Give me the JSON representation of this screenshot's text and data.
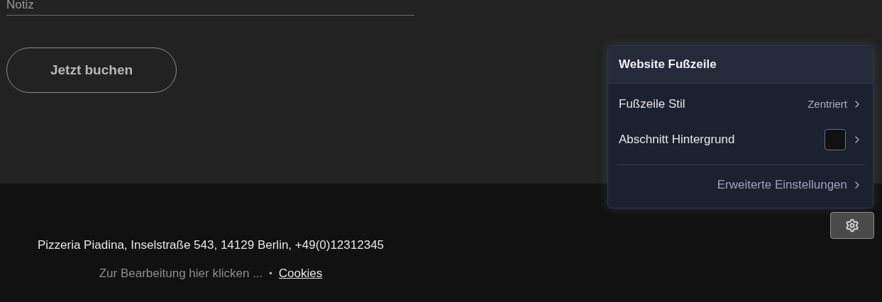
{
  "form": {
    "note_field": {
      "placeholder": "Notiz"
    },
    "submit_button": "Jetzt buchen"
  },
  "footer": {
    "address": "Pizzeria Piadina, Inselstraße 543, 14129 Berlin, +49(0)12312345",
    "edit_hint": "Zur Bearbeitung hier klicken ...",
    "separator": "•",
    "link": "Cookies"
  },
  "settings_panel": {
    "title": "Website Fußzeile",
    "rows": [
      {
        "kind": "value",
        "label": "Fußzeile Stil",
        "value": "Zentriert"
      },
      {
        "kind": "color",
        "label": "Abschnitt Hintergrund",
        "color": "#111111"
      }
    ],
    "advanced_link": "Erweiterte Einstellungen"
  }
}
